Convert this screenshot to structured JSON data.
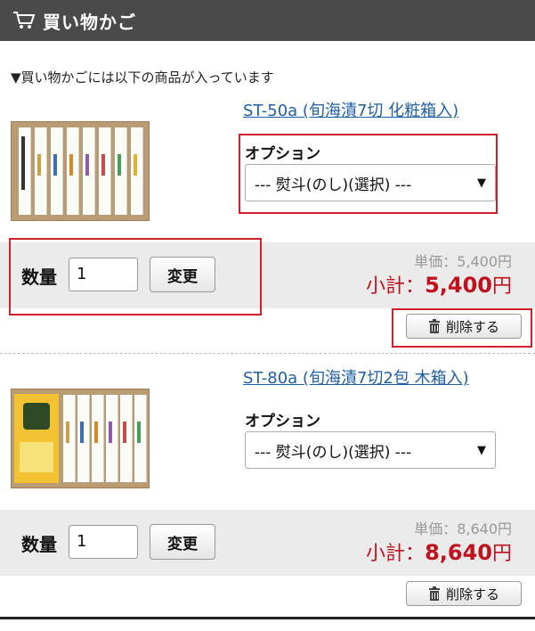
{
  "header": {
    "title": "買い物かご",
    "icon": "cart-icon"
  },
  "notice": "▼買い物かごには以下の商品が入っています",
  "items": [
    {
      "product_name": "ST-50a (旬海漬7切 化粧箱入)",
      "option_label": "オプション",
      "option_selected": "--- 熨斗(のし)(選択) ---",
      "qty_label": "数量",
      "qty_value": "1",
      "change_label": "変更",
      "unit_price": "単価：5,400円",
      "subtotal_label": "小計：",
      "subtotal_value": "5,400",
      "subtotal_unit": "円",
      "delete_label": "削除する"
    },
    {
      "product_name": "ST-80a (旬海漬7切2包 木箱入)",
      "option_label": "オプション",
      "option_selected": "--- 熨斗(のし)(選択) ---",
      "qty_label": "数量",
      "qty_value": "1",
      "change_label": "変更",
      "unit_price": "単価：8,640円",
      "subtotal_label": "小計：",
      "subtotal_value": "8,640",
      "subtotal_unit": "円",
      "delete_label": "削除する"
    }
  ],
  "colors": {
    "header_bg": "#4a4a4a",
    "link": "#1f5fa6",
    "price": "#c0111c",
    "highlight": "#d0202a"
  }
}
